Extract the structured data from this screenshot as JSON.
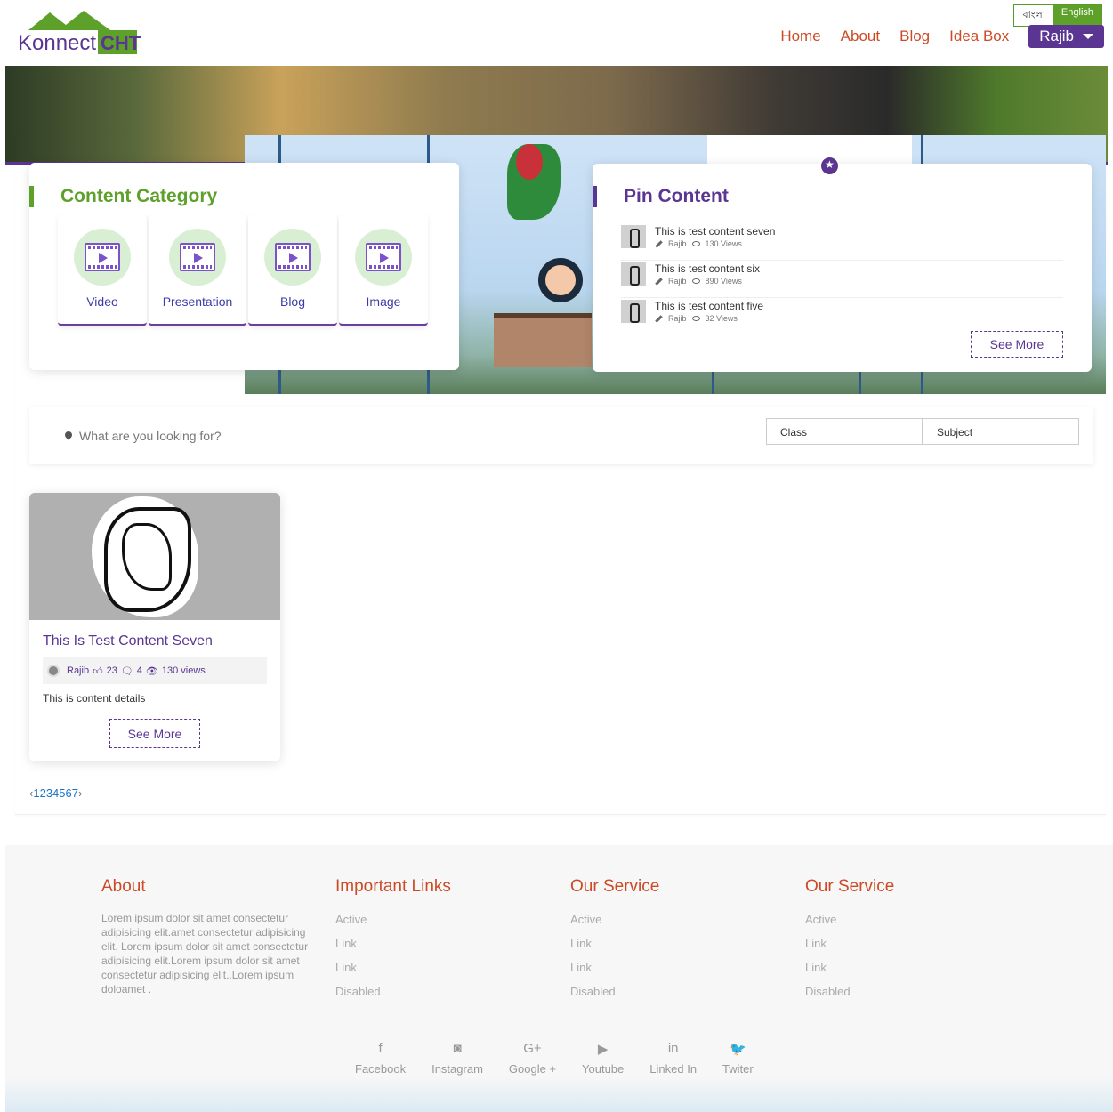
{
  "header": {
    "logo_text": "Konnect CHT",
    "lang": {
      "bn": "বাংলা",
      "en": "English"
    },
    "nav": [
      "Home",
      "About",
      "Blog",
      "Idea Box"
    ],
    "user": "Rajib"
  },
  "category": {
    "title": "Content Category",
    "items": [
      "Video",
      "Presentation",
      "Blog",
      "Image"
    ]
  },
  "pin": {
    "title": "Pin Content",
    "items": [
      {
        "title": "This is test content seven",
        "author": "Rajib",
        "views": "130 Views"
      },
      {
        "title": "This is test content six",
        "author": "Rajib",
        "views": "890 Views"
      },
      {
        "title": "This is test content five",
        "author": "Rajib",
        "views": "32 Views"
      }
    ],
    "see_more": "See More"
  },
  "search": {
    "placeholder": "What are you looking for?",
    "class_label": "Class",
    "subject_label": "Subject"
  },
  "content": {
    "title": "This Is Test Content Seven",
    "author": "Rajib",
    "likes": "23",
    "comments": "4",
    "views": "130 views",
    "desc": "This is content details",
    "see_more": "See More"
  },
  "pager": {
    "prev": "‹",
    "pages": [
      "1",
      "2",
      "3",
      "4",
      "5",
      "6",
      "7"
    ],
    "next": "›"
  },
  "footer": {
    "about_title": "About",
    "about_text": "Lorem ipsum dolor sit amet consectetur adipisicing elit.amet consectetur adipisicing elit. Lorem ipsum dolor sit amet consectetur adipisicing elit.Lorem ipsum dolor sit amet consectetur adipisicing elit..Lorem ipsum doloamet .",
    "cols": [
      {
        "title": "Important Links",
        "links": [
          "Active",
          "Link",
          "Link",
          "Disabled"
        ]
      },
      {
        "title": "Our Service",
        "links": [
          "Active",
          "Link",
          "Link",
          "Disabled"
        ]
      },
      {
        "title": "Our Service",
        "links": [
          "Active",
          "Link",
          "Link",
          "Disabled"
        ]
      }
    ],
    "social": [
      {
        "icon": "facebook-icon",
        "glyph": "f",
        "label": "Facebook"
      },
      {
        "icon": "instagram-icon",
        "glyph": "◙",
        "label": "Instagram"
      },
      {
        "icon": "google-plus-icon",
        "glyph": "G+",
        "label": "Google +"
      },
      {
        "icon": "youtube-icon",
        "glyph": "▶",
        "label": "Youtube"
      },
      {
        "icon": "linkedin-icon",
        "glyph": "in",
        "label": "Linked In"
      },
      {
        "icon": "twitter-icon",
        "glyph": "🐦",
        "label": "Twiter"
      }
    ]
  },
  "colors": {
    "accent_green": "#5da12b",
    "accent_purple": "#5b3592",
    "accent_orange": "#cc4b26"
  }
}
